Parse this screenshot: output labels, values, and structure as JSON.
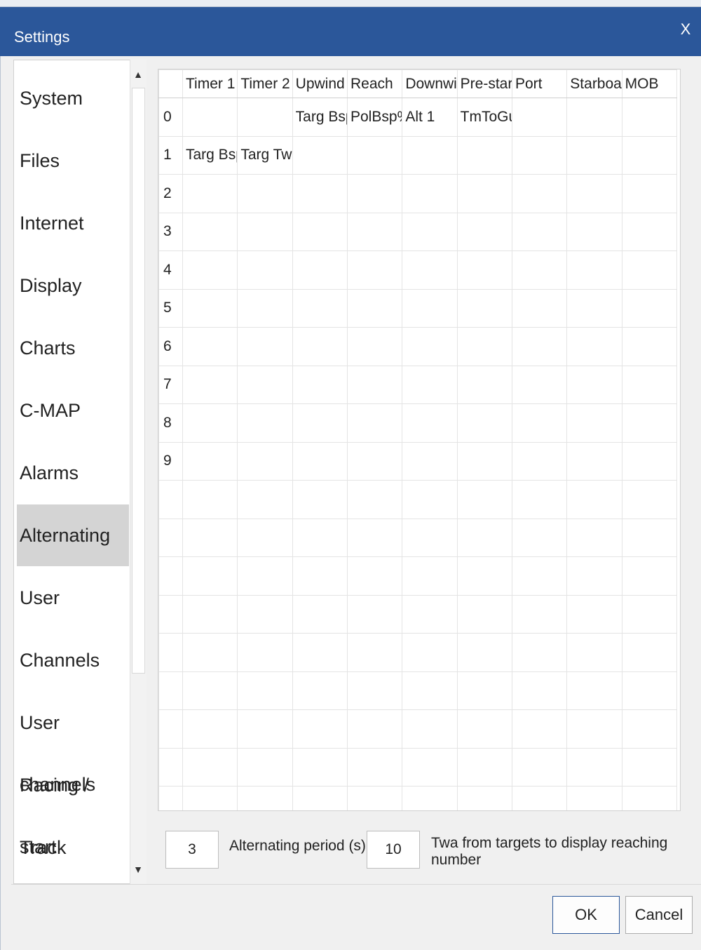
{
  "window": {
    "title": "Settings",
    "close_glyph": "X"
  },
  "sidebar": {
    "items": [
      {
        "label": "System",
        "active": false
      },
      {
        "label": "Files",
        "active": false
      },
      {
        "label": "Internet",
        "active": false
      },
      {
        "label": "Display",
        "active": false
      },
      {
        "label": "Charts",
        "active": false
      },
      {
        "label": "C-MAP",
        "active": false
      },
      {
        "label": "Alarms",
        "active": false
      },
      {
        "label": "Alternating",
        "active": true
      },
      {
        "label": "User",
        "active": false
      },
      {
        "label": "Channels",
        "active": false
      },
      {
        "label": "User channels",
        "active": false
      },
      {
        "label": "Racing / start",
        "active": false
      },
      {
        "label": "Track",
        "active": false
      }
    ],
    "scroll_up_glyph": "▲",
    "scroll_down_glyph": "▼"
  },
  "grid": {
    "columns": [
      "Timer 1",
      "Timer 2",
      "Upwind",
      "Reach",
      "Downwind",
      "Pre-start",
      "Port",
      "Starboard",
      "MOB"
    ],
    "rows": [
      {
        "index": "0",
        "cells": [
          "",
          "",
          "Targ Bsp",
          "PolBsp%",
          "Alt 1",
          "TmToGun",
          "",
          "",
          ""
        ]
      },
      {
        "index": "1",
        "cells": [
          "Targ Bsp",
          "Targ Twa",
          "",
          "",
          "",
          "",
          "",
          "",
          ""
        ]
      },
      {
        "index": "2",
        "cells": [
          "",
          "",
          "",
          "",
          "",
          "",
          "",
          "",
          ""
        ]
      },
      {
        "index": "3",
        "cells": [
          "",
          "",
          "",
          "",
          "",
          "",
          "",
          "",
          ""
        ]
      },
      {
        "index": "4",
        "cells": [
          "",
          "",
          "",
          "",
          "",
          "",
          "",
          "",
          ""
        ]
      },
      {
        "index": "5",
        "cells": [
          "",
          "",
          "",
          "",
          "",
          "",
          "",
          "",
          ""
        ]
      },
      {
        "index": "6",
        "cells": [
          "",
          "",
          "",
          "",
          "",
          "",
          "",
          "",
          ""
        ]
      },
      {
        "index": "7",
        "cells": [
          "",
          "",
          "",
          "",
          "",
          "",
          "",
          "",
          ""
        ]
      },
      {
        "index": "8",
        "cells": [
          "",
          "",
          "",
          "",
          "",
          "",
          "",
          "",
          ""
        ]
      },
      {
        "index": "9",
        "cells": [
          "",
          "",
          "",
          "",
          "",
          "",
          "",
          "",
          ""
        ]
      },
      {
        "index": "",
        "cells": [
          "",
          "",
          "",
          "",
          "",
          "",
          "",
          "",
          ""
        ]
      },
      {
        "index": "",
        "cells": [
          "",
          "",
          "",
          "",
          "",
          "",
          "",
          "",
          ""
        ]
      },
      {
        "index": "",
        "cells": [
          "",
          "",
          "",
          "",
          "",
          "",
          "",
          "",
          ""
        ]
      },
      {
        "index": "",
        "cells": [
          "",
          "",
          "",
          "",
          "",
          "",
          "",
          "",
          ""
        ]
      },
      {
        "index": "",
        "cells": [
          "",
          "",
          "",
          "",
          "",
          "",
          "",
          "",
          ""
        ]
      },
      {
        "index": "",
        "cells": [
          "",
          "",
          "",
          "",
          "",
          "",
          "",
          "",
          ""
        ]
      },
      {
        "index": "",
        "cells": [
          "",
          "",
          "",
          "",
          "",
          "",
          "",
          "",
          ""
        ]
      },
      {
        "index": "",
        "cells": [
          "",
          "",
          "",
          "",
          "",
          "",
          "",
          "",
          ""
        ]
      },
      {
        "index": "",
        "cells": [
          "",
          "",
          "",
          "",
          "",
          "",
          "",
          "",
          ""
        ]
      }
    ]
  },
  "options": {
    "alternating_period": {
      "value": "3",
      "label": "Alternating period (s)"
    },
    "twa_reaching": {
      "value": "10",
      "label": "Twa from targets to display reaching number"
    }
  },
  "buttons": {
    "ok": "OK",
    "cancel": "Cancel"
  },
  "colors": {
    "titlebar": "#2b579a",
    "active_item": "#d4d4d4"
  }
}
